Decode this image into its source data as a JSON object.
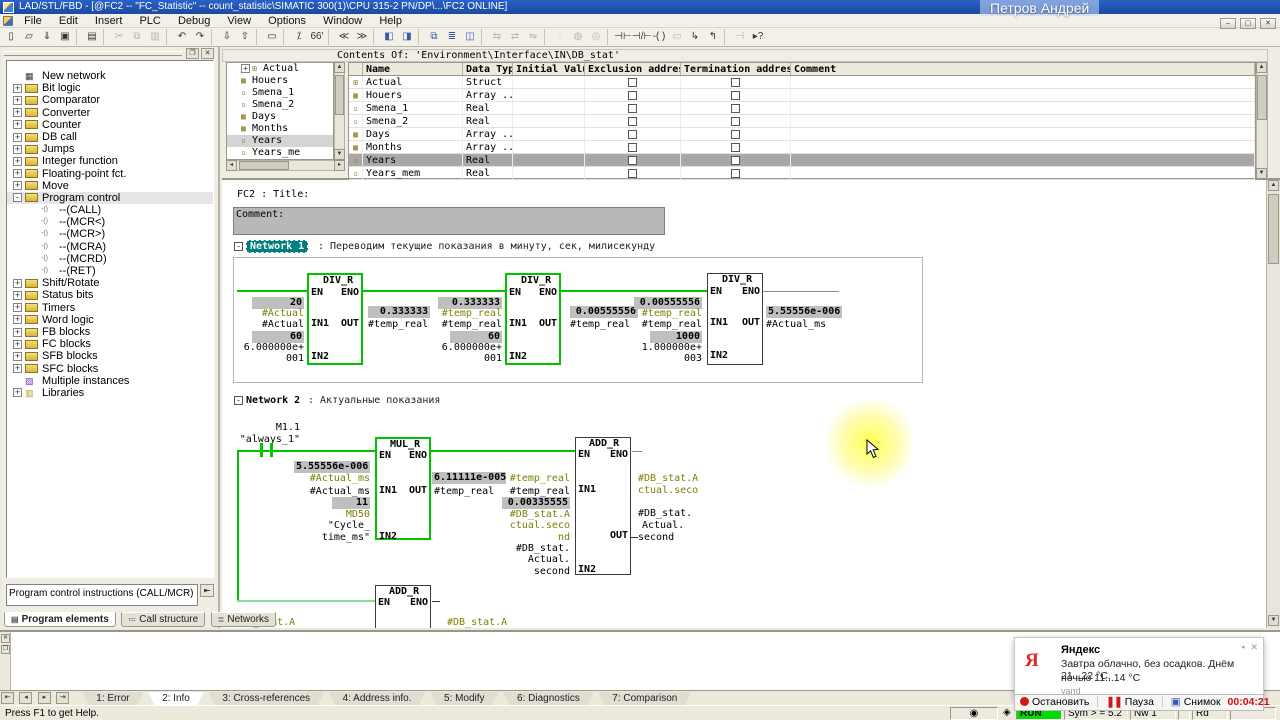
{
  "colors": {
    "titlebar_blue": "#2a62c9",
    "accent_green": "#00c400",
    "symbol_olive": "#7e7e00",
    "network_teal": "#007d7d",
    "value_gray": "#bfbfbf",
    "selection_gray": "#a8a8a8",
    "run_green": "#00dd00",
    "record_red": "#cc1111"
  },
  "icons": {
    "min": "–",
    "max": "▢",
    "close": "✕",
    "up": "▲",
    "down": "▼",
    "left": "◂",
    "right": "▸",
    "first": "⇤",
    "last": "⇥",
    "dock": "❐",
    "pin": "▪",
    "hmenu": "▪",
    "coil_item": "-()",
    "netic": "▦",
    "multi": "▨",
    "lib": "▥",
    "desc_toggle": "⇤",
    "strip_close": "✕",
    "strip_dock": "❐",
    "yandex_menu": "▪"
  },
  "window": {
    "title": "LAD/STL/FBD - [@FC2 -- \"FC_Statistic\" -- count_statistic\\SIMATIC 300(1)\\CPU 315-2 PN/DP\\...\\FC2  ONLINE]",
    "watermark": "Петров Андрей"
  },
  "menu": {
    "items": [
      "File",
      "Edit",
      "Insert",
      "PLC",
      "Debug",
      "View",
      "Options",
      "Window",
      "Help"
    ]
  },
  "toolbar": {
    "buttons": [
      {
        "name": "new-file",
        "glyph": "▯"
      },
      {
        "name": "open-file",
        "glyph": "▱"
      },
      {
        "name": "save-as",
        "glyph": "⇓"
      },
      {
        "name": "save",
        "glyph": "▣"
      },
      {
        "name": "print",
        "glyph": "▤"
      },
      {
        "name": "cut",
        "glyph": "✂",
        "muted": true
      },
      {
        "name": "copy",
        "glyph": "⧉",
        "muted": true
      },
      {
        "name": "paste",
        "glyph": "▥",
        "muted": true
      },
      {
        "name": "undo",
        "glyph": "↶"
      },
      {
        "name": "redo",
        "glyph": "↷"
      },
      {
        "name": "download",
        "glyph": "⇩"
      },
      {
        "name": "upload",
        "glyph": "⇧"
      },
      {
        "name": "symbol-representation",
        "glyph": "▭"
      },
      {
        "name": "address-info",
        "glyph": "⁒"
      },
      {
        "name": "monitor-on-off",
        "glyph": "66'"
      },
      {
        "name": "first-network",
        "glyph": "≪"
      },
      {
        "name": "last-network",
        "glyph": "≫"
      },
      {
        "name": "overview-window",
        "glyph": "◧",
        "blue": true
      },
      {
        "name": "detail-window",
        "glyph": "◨",
        "blue": true
      },
      {
        "name": "call-structure",
        "glyph": "⧉",
        "blue": true
      },
      {
        "name": "data-view",
        "glyph": "≣",
        "blue": true
      },
      {
        "name": "split-window",
        "glyph": "◫",
        "blue": true
      },
      {
        "name": "compare-blocks",
        "glyph": "⇆",
        "muted": true
      },
      {
        "name": "cross-reference",
        "glyph": "⇄",
        "muted": true
      },
      {
        "name": "block-info",
        "glyph": "⇋",
        "muted": true
      },
      {
        "name": "set-breakpoint",
        "glyph": "◌",
        "muted": true
      },
      {
        "name": "breakpoints-active",
        "glyph": "◍",
        "muted": true
      },
      {
        "name": "edit-breakpoints",
        "glyph": "◎",
        "muted": true
      },
      {
        "name": "contact-no",
        "glyph": "⊣⊢"
      },
      {
        "name": "contact-nc",
        "glyph": "⊣/⊢"
      },
      {
        "name": "coil",
        "glyph": "-( )"
      },
      {
        "name": "empty-box",
        "glyph": "▭",
        "muted": true
      },
      {
        "name": "open-branch",
        "glyph": "↳"
      },
      {
        "name": "close-branch",
        "glyph": "↰"
      },
      {
        "name": "connector",
        "glyph": "⊣",
        "muted": true
      },
      {
        "name": "help-pointer",
        "glyph": "▸?"
      }
    ]
  },
  "sidebar": {
    "items": [
      {
        "label": "New network",
        "kind": "network"
      },
      {
        "label": "Bit logic",
        "exp": "+"
      },
      {
        "label": "Comparator",
        "exp": "+"
      },
      {
        "label": "Converter",
        "exp": "+"
      },
      {
        "label": "Counter",
        "exp": "+"
      },
      {
        "label": "DB call",
        "exp": "+"
      },
      {
        "label": "Jumps",
        "exp": "+"
      },
      {
        "label": "Integer function",
        "exp": "+"
      },
      {
        "label": "Floating-point fct.",
        "exp": "+"
      },
      {
        "label": "Move",
        "exp": "+"
      },
      {
        "label": "Program control",
        "exp": "-",
        "selected": true
      },
      {
        "label": "--(CALL)",
        "kind": "child"
      },
      {
        "label": "--(MCR<)",
        "kind": "child"
      },
      {
        "label": "--(MCR>)",
        "kind": "child"
      },
      {
        "label": "--(MCRA)",
        "kind": "child"
      },
      {
        "label": "--(MCRD)",
        "kind": "child"
      },
      {
        "label": "--(RET)",
        "kind": "child"
      },
      {
        "label": "Shift/Rotate",
        "exp": "+"
      },
      {
        "label": "Status bits",
        "exp": "+"
      },
      {
        "label": "Timers",
        "exp": "+"
      },
      {
        "label": "Word logic",
        "exp": "+"
      },
      {
        "label": "FB blocks",
        "exp": "+"
      },
      {
        "label": "FC blocks",
        "exp": "+"
      },
      {
        "label": "SFB blocks",
        "exp": "+"
      },
      {
        "label": "SFC blocks",
        "exp": "+"
      },
      {
        "label": "Multiple instances",
        "kind": "multi"
      },
      {
        "label": "Libraries",
        "exp": "+",
        "kind": "lib"
      }
    ],
    "description": "Program control instructions (CALL/MCR)",
    "tabs": [
      "Program elements",
      "Call structure",
      "Networks"
    ]
  },
  "vartable": {
    "header": "Contents Of: 'Environment\\Interface\\IN\\DB_stat'",
    "tree": [
      {
        "label": "Actual",
        "exp": "+",
        "icon": "⊞"
      },
      {
        "label": "Houers",
        "icon": "▦"
      },
      {
        "label": "Smena_1",
        "icon": "▫"
      },
      {
        "label": "Smena_2",
        "icon": "▫"
      },
      {
        "label": "Days",
        "icon": "▦"
      },
      {
        "label": "Months",
        "icon": "▦"
      },
      {
        "label": "Years",
        "icon": "▫",
        "selected": true
      },
      {
        "label": "Years_me",
        "icon": "▫"
      }
    ],
    "columns": [
      "Name",
      "Data Type",
      "Initial Value",
      "Exclusion address",
      "Termination address",
      "Comment"
    ],
    "rows": [
      {
        "icon": "⊞",
        "name": "Actual",
        "type": "Struct"
      },
      {
        "icon": "▦",
        "name": "Houers",
        "type": "Array ..."
      },
      {
        "icon": "▫",
        "name": "Smena_1",
        "type": "Real"
      },
      {
        "icon": "▫",
        "name": "Smena_2",
        "type": "Real"
      },
      {
        "icon": "▦",
        "name": "Days",
        "type": "Array ..."
      },
      {
        "icon": "▦",
        "name": "Months",
        "type": "Array ..."
      },
      {
        "icon": "▫",
        "name": "Years",
        "type": "Real",
        "selected": true
      },
      {
        "icon": "▫",
        "name": "Years_mem",
        "type": "Real"
      }
    ]
  },
  "editor": {
    "fc_title": "FC2 : Title:",
    "comment": "Comment:",
    "net1_label": "Network 1",
    "net1_comment": ": Переводим текущие показания в минуту, сек, милисекунду",
    "net2_label": "Network 2",
    "net2_comment": ": Актуальные показания",
    "collapse": "-",
    "pins": {
      "en": "EN",
      "eno": "ENO",
      "in1": "IN1",
      "in2": "IN2",
      "out": "OUT"
    },
    "div1": {
      "title": "DIV_R",
      "in1_val": "20",
      "in1_sym": "#Actual",
      "in1_addr": "#Actual",
      "in2_val": "60",
      "in2_m": "6.000000e+",
      "in2_e": "001",
      "out_val": "0.333333",
      "out_addr": "#temp_real"
    },
    "div2": {
      "title": "DIV_R",
      "in1_val": "0.333333",
      "in1_sym": "#temp_real",
      "in1_addr": "#temp_real",
      "in2_val": "60",
      "in2_m": "6.000000e+",
      "in2_e": "001",
      "out_val": "0.00555556",
      "out_addr": "#temp_real"
    },
    "div3": {
      "title": "DIV_R",
      "in1_val": "0.00555556",
      "in1_sym": "#temp_real",
      "in1_addr": "#temp_real",
      "in2_val": "1000",
      "in2_m": "1.000000e+",
      "in2_e": "003",
      "out_val": "5.55556e-006",
      "out_addr": "#Actual_ms"
    },
    "contact": {
      "addr": "M1.1",
      "sym": "\"always_1\""
    },
    "mul": {
      "title": "MUL_R",
      "in1_val": "5.55556e-006",
      "in1_sym": "#Actual_ms",
      "in1_addr": "#Actual_ms",
      "in2_val": "11",
      "in2_sym": "MD50",
      "in2_a1": "\"Cycle_",
      "in2_a2": "time_ms\"",
      "out_val": "6.11111e-005",
      "out_addr": "#temp_real"
    },
    "add1": {
      "title": "ADD_R",
      "in1_sym": "#temp_real",
      "in1_addr": "#temp_real",
      "in2_val": "0.00335555",
      "in2_s1": "#DB_stat.A",
      "in2_s2": "ctual.seco",
      "in2_s3": "nd",
      "in2_a1": "#DB_stat.",
      "in2_a2": "Actual.",
      "in2_a3": "second",
      "out_s1": "#DB_stat.A",
      "out_s2": "ctual.seco",
      "out_a1": "#DB_stat.",
      "out_a2": "Actual.",
      "out_a3": "second"
    },
    "add2": {
      "title": "ADD_R",
      "left_sym": "#DB_stat.A",
      "right_sym": "#DB_stat.A"
    }
  },
  "output": {
    "tabs": [
      "1: Error",
      "2: Info",
      "3: Cross-references",
      "4: Address info.",
      "5: Modify",
      "6: Diagnostics",
      "7: Comparison"
    ]
  },
  "status": {
    "help": "Press F1 to get Help.",
    "mode_icon": "◉",
    "key_icon": "◈",
    "run": "RUN",
    "sym": "Sym > = 5.2",
    "nw": "Nw 1",
    "rd": "Rd"
  },
  "recorder": {
    "stop": "Остановить",
    "pause": "Пауза",
    "pause_icon": "❚❚",
    "snapshot": "Снимок",
    "time": "00:04:21"
  },
  "notification": {
    "logo": "Я",
    "title": "Яндекс",
    "line1": "Завтра облачно, без осадков. Днём 21...22 °C,",
    "line2": "ночью 11...14 °C",
    "source": "yand"
  }
}
